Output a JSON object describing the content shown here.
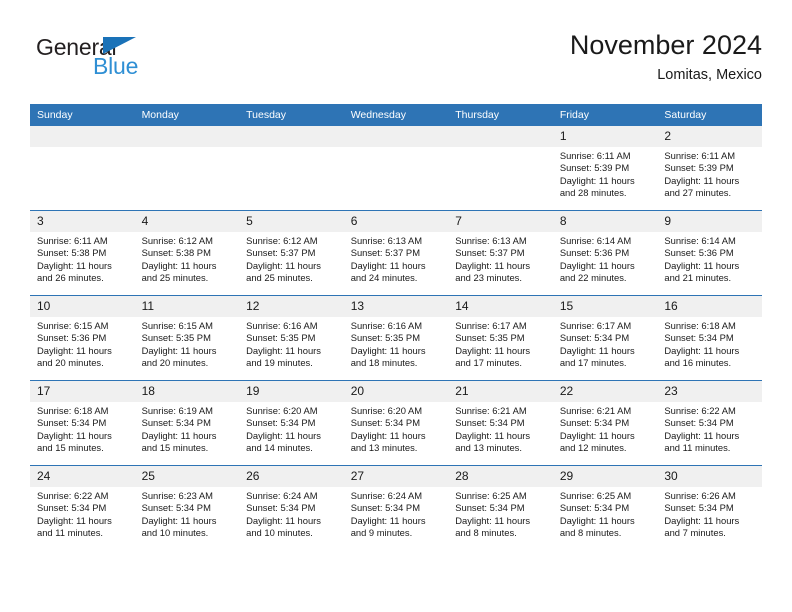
{
  "brand": {
    "name_part1": "General",
    "name_part2": "Blue",
    "triangle_color": "#1a72b8",
    "blue_color": "#2f8fd4"
  },
  "header": {
    "title": "November 2024",
    "subtitle": "Lomitas, Mexico"
  },
  "theme": {
    "header_blue": "#2e74b5",
    "daynum_gray": "#f0f0f0",
    "text": "#1a1a1a"
  },
  "calendar": {
    "weekday_headers": [
      "Sunday",
      "Monday",
      "Tuesday",
      "Wednesday",
      "Thursday",
      "Friday",
      "Saturday"
    ],
    "weeks": [
      [
        {
          "day": "",
          "empty": true
        },
        {
          "day": "",
          "empty": true
        },
        {
          "day": "",
          "empty": true
        },
        {
          "day": "",
          "empty": true
        },
        {
          "day": "",
          "empty": true
        },
        {
          "day": "1",
          "sunrise": "Sunrise: 6:11 AM",
          "sunset": "Sunset: 5:39 PM",
          "daylight": "Daylight: 11 hours and 28 minutes."
        },
        {
          "day": "2",
          "sunrise": "Sunrise: 6:11 AM",
          "sunset": "Sunset: 5:39 PM",
          "daylight": "Daylight: 11 hours and 27 minutes."
        }
      ],
      [
        {
          "day": "3",
          "sunrise": "Sunrise: 6:11 AM",
          "sunset": "Sunset: 5:38 PM",
          "daylight": "Daylight: 11 hours and 26 minutes."
        },
        {
          "day": "4",
          "sunrise": "Sunrise: 6:12 AM",
          "sunset": "Sunset: 5:38 PM",
          "daylight": "Daylight: 11 hours and 25 minutes."
        },
        {
          "day": "5",
          "sunrise": "Sunrise: 6:12 AM",
          "sunset": "Sunset: 5:37 PM",
          "daylight": "Daylight: 11 hours and 25 minutes."
        },
        {
          "day": "6",
          "sunrise": "Sunrise: 6:13 AM",
          "sunset": "Sunset: 5:37 PM",
          "daylight": "Daylight: 11 hours and 24 minutes."
        },
        {
          "day": "7",
          "sunrise": "Sunrise: 6:13 AM",
          "sunset": "Sunset: 5:37 PM",
          "daylight": "Daylight: 11 hours and 23 minutes."
        },
        {
          "day": "8",
          "sunrise": "Sunrise: 6:14 AM",
          "sunset": "Sunset: 5:36 PM",
          "daylight": "Daylight: 11 hours and 22 minutes."
        },
        {
          "day": "9",
          "sunrise": "Sunrise: 6:14 AM",
          "sunset": "Sunset: 5:36 PM",
          "daylight": "Daylight: 11 hours and 21 minutes."
        }
      ],
      [
        {
          "day": "10",
          "sunrise": "Sunrise: 6:15 AM",
          "sunset": "Sunset: 5:36 PM",
          "daylight": "Daylight: 11 hours and 20 minutes."
        },
        {
          "day": "11",
          "sunrise": "Sunrise: 6:15 AM",
          "sunset": "Sunset: 5:35 PM",
          "daylight": "Daylight: 11 hours and 20 minutes."
        },
        {
          "day": "12",
          "sunrise": "Sunrise: 6:16 AM",
          "sunset": "Sunset: 5:35 PM",
          "daylight": "Daylight: 11 hours and 19 minutes."
        },
        {
          "day": "13",
          "sunrise": "Sunrise: 6:16 AM",
          "sunset": "Sunset: 5:35 PM",
          "daylight": "Daylight: 11 hours and 18 minutes."
        },
        {
          "day": "14",
          "sunrise": "Sunrise: 6:17 AM",
          "sunset": "Sunset: 5:35 PM",
          "daylight": "Daylight: 11 hours and 17 minutes."
        },
        {
          "day": "15",
          "sunrise": "Sunrise: 6:17 AM",
          "sunset": "Sunset: 5:34 PM",
          "daylight": "Daylight: 11 hours and 17 minutes."
        },
        {
          "day": "16",
          "sunrise": "Sunrise: 6:18 AM",
          "sunset": "Sunset: 5:34 PM",
          "daylight": "Daylight: 11 hours and 16 minutes."
        }
      ],
      [
        {
          "day": "17",
          "sunrise": "Sunrise: 6:18 AM",
          "sunset": "Sunset: 5:34 PM",
          "daylight": "Daylight: 11 hours and 15 minutes."
        },
        {
          "day": "18",
          "sunrise": "Sunrise: 6:19 AM",
          "sunset": "Sunset: 5:34 PM",
          "daylight": "Daylight: 11 hours and 15 minutes."
        },
        {
          "day": "19",
          "sunrise": "Sunrise: 6:20 AM",
          "sunset": "Sunset: 5:34 PM",
          "daylight": "Daylight: 11 hours and 14 minutes."
        },
        {
          "day": "20",
          "sunrise": "Sunrise: 6:20 AM",
          "sunset": "Sunset: 5:34 PM",
          "daylight": "Daylight: 11 hours and 13 minutes."
        },
        {
          "day": "21",
          "sunrise": "Sunrise: 6:21 AM",
          "sunset": "Sunset: 5:34 PM",
          "daylight": "Daylight: 11 hours and 13 minutes."
        },
        {
          "day": "22",
          "sunrise": "Sunrise: 6:21 AM",
          "sunset": "Sunset: 5:34 PM",
          "daylight": "Daylight: 11 hours and 12 minutes."
        },
        {
          "day": "23",
          "sunrise": "Sunrise: 6:22 AM",
          "sunset": "Sunset: 5:34 PM",
          "daylight": "Daylight: 11 hours and 11 minutes."
        }
      ],
      [
        {
          "day": "24",
          "sunrise": "Sunrise: 6:22 AM",
          "sunset": "Sunset: 5:34 PM",
          "daylight": "Daylight: 11 hours and 11 minutes."
        },
        {
          "day": "25",
          "sunrise": "Sunrise: 6:23 AM",
          "sunset": "Sunset: 5:34 PM",
          "daylight": "Daylight: 11 hours and 10 minutes."
        },
        {
          "day": "26",
          "sunrise": "Sunrise: 6:24 AM",
          "sunset": "Sunset: 5:34 PM",
          "daylight": "Daylight: 11 hours and 10 minutes."
        },
        {
          "day": "27",
          "sunrise": "Sunrise: 6:24 AM",
          "sunset": "Sunset: 5:34 PM",
          "daylight": "Daylight: 11 hours and 9 minutes."
        },
        {
          "day": "28",
          "sunrise": "Sunrise: 6:25 AM",
          "sunset": "Sunset: 5:34 PM",
          "daylight": "Daylight: 11 hours and 8 minutes."
        },
        {
          "day": "29",
          "sunrise": "Sunrise: 6:25 AM",
          "sunset": "Sunset: 5:34 PM",
          "daylight": "Daylight: 11 hours and 8 minutes."
        },
        {
          "day": "30",
          "sunrise": "Sunrise: 6:26 AM",
          "sunset": "Sunset: 5:34 PM",
          "daylight": "Daylight: 11 hours and 7 minutes."
        }
      ]
    ]
  }
}
